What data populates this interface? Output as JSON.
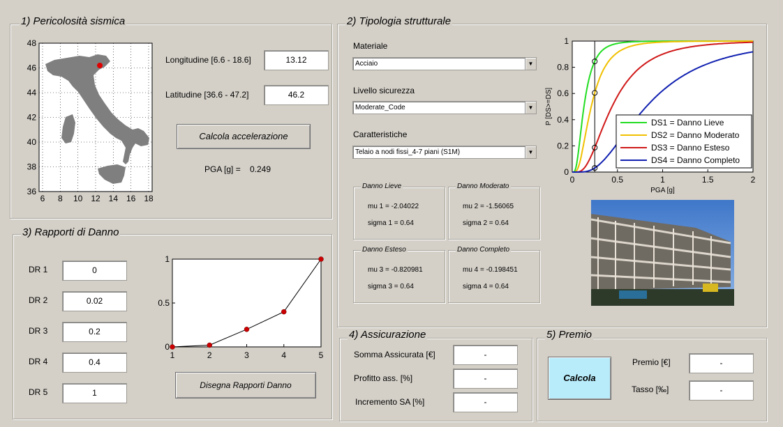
{
  "sections": {
    "seismic": {
      "title": "1) Pericolosità sismica"
    },
    "structure": {
      "title": "2) Tipologia strutturale"
    },
    "damage": {
      "title": "3) Rapporti di Danno"
    },
    "insurance": {
      "title": "4) Assicurazione"
    },
    "premium": {
      "title": "5) Premio"
    }
  },
  "map": {
    "y_ticks": [
      "48",
      "46",
      "44",
      "42",
      "40",
      "38",
      "36"
    ],
    "x_ticks": [
      "6",
      "8",
      "10",
      "12",
      "14",
      "16",
      "18"
    ],
    "location_color": "#e00000"
  },
  "seismic": {
    "lon_label": "Longitudine [6.6 - 18.6]",
    "lon_value": "13.12",
    "lat_label": "Latitudine [36.6 - 47.2]",
    "lat_value": "46.2",
    "calc_button": "Calcola accelerazione",
    "pga_label": "PGA [g] =",
    "pga_value": "0.249"
  },
  "structure": {
    "material_label": "Materiale",
    "material_value": "Acciaio",
    "safety_label": "Livello sicurezza",
    "safety_value": "Moderate_Code",
    "char_label": "Caratteristiche",
    "char_value": "Telaio a nodi fissi_4-7 piani (S1M)",
    "states": [
      {
        "title": "Danno Lieve",
        "mu": "mu 1 = -2.04022",
        "sigma": "sigma 1 = 0.64"
      },
      {
        "title": "Danno Moderato",
        "mu": "mu 2 = -1.56065",
        "sigma": "sigma 2 = 0.64"
      },
      {
        "title": "Danno Esteso",
        "mu": "mu 3 = -0.820981",
        "sigma": "sigma 3 = 0.64"
      },
      {
        "title": "Danno Completo",
        "mu": "mu 4 = -0.198451",
        "sigma": "sigma 4 = 0.64"
      }
    ]
  },
  "damage": {
    "labels": [
      "DR 1",
      "DR 2",
      "DR 3",
      "DR 4",
      "DR 5"
    ],
    "values": [
      "0",
      "0.02",
      "0.2",
      "0.4",
      "1"
    ],
    "draw_button": "Disegna Rapporti Danno"
  },
  "insurance": {
    "rows": [
      {
        "label": "Somma Assicurata [€]",
        "value": "-"
      },
      {
        "label": "Profitto ass. [%]",
        "value": "-"
      },
      {
        "label": "Incremento SA [%]",
        "value": "-"
      }
    ]
  },
  "premium": {
    "button": "Calcola",
    "button_color": "#b8ecfb",
    "rows": [
      {
        "label": "Premio [€]",
        "value": "-"
      },
      {
        "label": "Tasso [‰]",
        "value": "-"
      }
    ]
  },
  "chart_data": [
    {
      "type": "line",
      "title": "",
      "xlabel": "PGA [g]",
      "ylabel": "P [DS>=DS]",
      "xlim": [
        0,
        2
      ],
      "ylim": [
        0,
        1
      ],
      "x_ticks": [
        "0",
        "0.5",
        "1",
        "1.5",
        "2"
      ],
      "y_ticks": [
        "0",
        "0.2",
        "0.4",
        "0.6",
        "0.8",
        "1"
      ],
      "legend_position": "bottom-right",
      "vertical_marker_x": 0.249,
      "series": [
        {
          "name": "DS1 = Danno Lieve",
          "color": "#22dd22",
          "mu": -2.04022,
          "sigma": 0.64
        },
        {
          "name": "DS2 = Danno Moderato",
          "color": "#f0c000",
          "mu": -1.56065,
          "sigma": 0.64
        },
        {
          "name": "DS3 = Danno Esteso",
          "color": "#d01818",
          "mu": -0.820981,
          "sigma": 0.64
        },
        {
          "name": "DS4 = Danno Completo",
          "color": "#1020b0",
          "mu": -0.198451,
          "sigma": 0.64
        }
      ]
    },
    {
      "type": "line",
      "title": "",
      "xlim": [
        1,
        5
      ],
      "ylim": [
        0,
        1
      ],
      "x_ticks": [
        "1",
        "2",
        "3",
        "4",
        "5"
      ],
      "y_ticks": [
        "0",
        "0.5",
        "1"
      ],
      "series": [
        {
          "x": [
            1,
            2,
            3,
            4,
            5
          ],
          "y": [
            0,
            0.02,
            0.2,
            0.4,
            1
          ],
          "marker_color": "#cc0000"
        }
      ]
    }
  ]
}
